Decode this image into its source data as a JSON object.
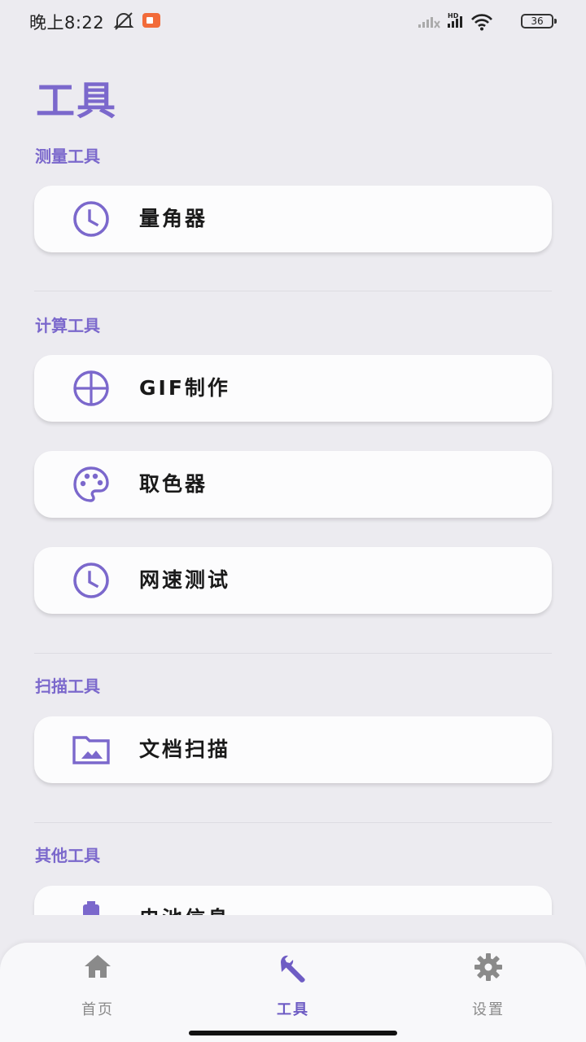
{
  "status_bar": {
    "time": "晚上8:22",
    "battery": "36",
    "network": "HD"
  },
  "page": {
    "title": "工具"
  },
  "sections": [
    {
      "title": "测量工具",
      "items": [
        {
          "label": "量角器",
          "icon": "clock-icon"
        }
      ]
    },
    {
      "title": "计算工具",
      "items": [
        {
          "label": "GIF制作",
          "icon": "crosshair-circle-icon"
        },
        {
          "label": "取色器",
          "icon": "palette-icon"
        },
        {
          "label": "网速测试",
          "icon": "clock-icon"
        }
      ]
    },
    {
      "title": "扫描工具",
      "items": [
        {
          "label": "文档扫描",
          "icon": "folder-image-icon"
        }
      ]
    },
    {
      "title": "其他工具",
      "items": [
        {
          "label": "电池信息",
          "icon": "battery-icon"
        }
      ]
    }
  ],
  "bottom_nav": {
    "items": [
      {
        "label": "首页",
        "icon": "home-icon"
      },
      {
        "label": "工具",
        "icon": "wrench-icon",
        "active": true
      },
      {
        "label": "设置",
        "icon": "gear-icon"
      }
    ]
  },
  "colors": {
    "accent": "#7B68CC",
    "background": "#ECEBF0",
    "card": "#FCFCFD"
  }
}
